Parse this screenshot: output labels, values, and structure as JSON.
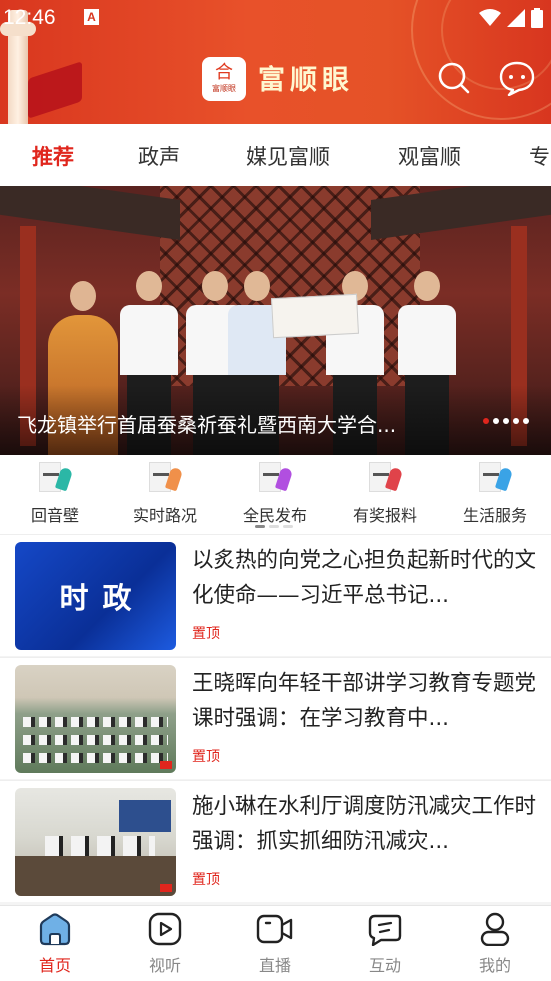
{
  "status_bar": {
    "time": "12:46",
    "notification_badge": "A"
  },
  "header": {
    "logo_text": "富顺眼",
    "logo_mark": "合",
    "title": "富顺眼"
  },
  "tabs": [
    {
      "label": "推荐",
      "active": true
    },
    {
      "label": "政声",
      "active": false
    },
    {
      "label": "媒见富顺",
      "active": false
    },
    {
      "label": "观富顺",
      "active": false
    },
    {
      "label": "专",
      "active": false
    }
  ],
  "banner": {
    "caption": "飞龙镇举行首届蚕桑祈蚕礼暨西南大学合...",
    "page_count": 5,
    "current_page": 1
  },
  "quick_entries": [
    {
      "label": "回音壁",
      "icon": "echo-wall-icon",
      "accent": "#2bb7a6"
    },
    {
      "label": "实时路况",
      "icon": "traffic-icon",
      "accent": "#f0904a"
    },
    {
      "label": "全民发布",
      "icon": "publish-icon",
      "accent": "#b14fe0"
    },
    {
      "label": "有奖报料",
      "icon": "report-icon",
      "accent": "#e0434a"
    },
    {
      "label": "生活服务",
      "icon": "life-service-icon",
      "accent": "#3aa3e6"
    }
  ],
  "news": [
    {
      "title": "以炙热的向党之心担负起新时代的文化使命——习近平总书记...",
      "tag": "置顶",
      "thumb_text": "时政"
    },
    {
      "title": "王晓晖向年轻干部讲学习教育专题党课时强调：在学习教育中...",
      "tag": "置顶",
      "thumb_text": ""
    },
    {
      "title": "施小琳在水利厅调度防汛减灾工作时强调：抓实抓细防汛减灾...",
      "tag": "置顶",
      "thumb_text": ""
    }
  ],
  "bottom_nav": [
    {
      "label": "首页",
      "icon": "home-icon",
      "active": true
    },
    {
      "label": "视听",
      "icon": "play-icon",
      "active": false
    },
    {
      "label": "直播",
      "icon": "video-camera-icon",
      "active": false
    },
    {
      "label": "互动",
      "icon": "interact-icon",
      "active": false
    },
    {
      "label": "我的",
      "icon": "user-icon",
      "active": false
    }
  ],
  "colors": {
    "brand_red": "#e0261d",
    "header_orange": "#e55227"
  }
}
